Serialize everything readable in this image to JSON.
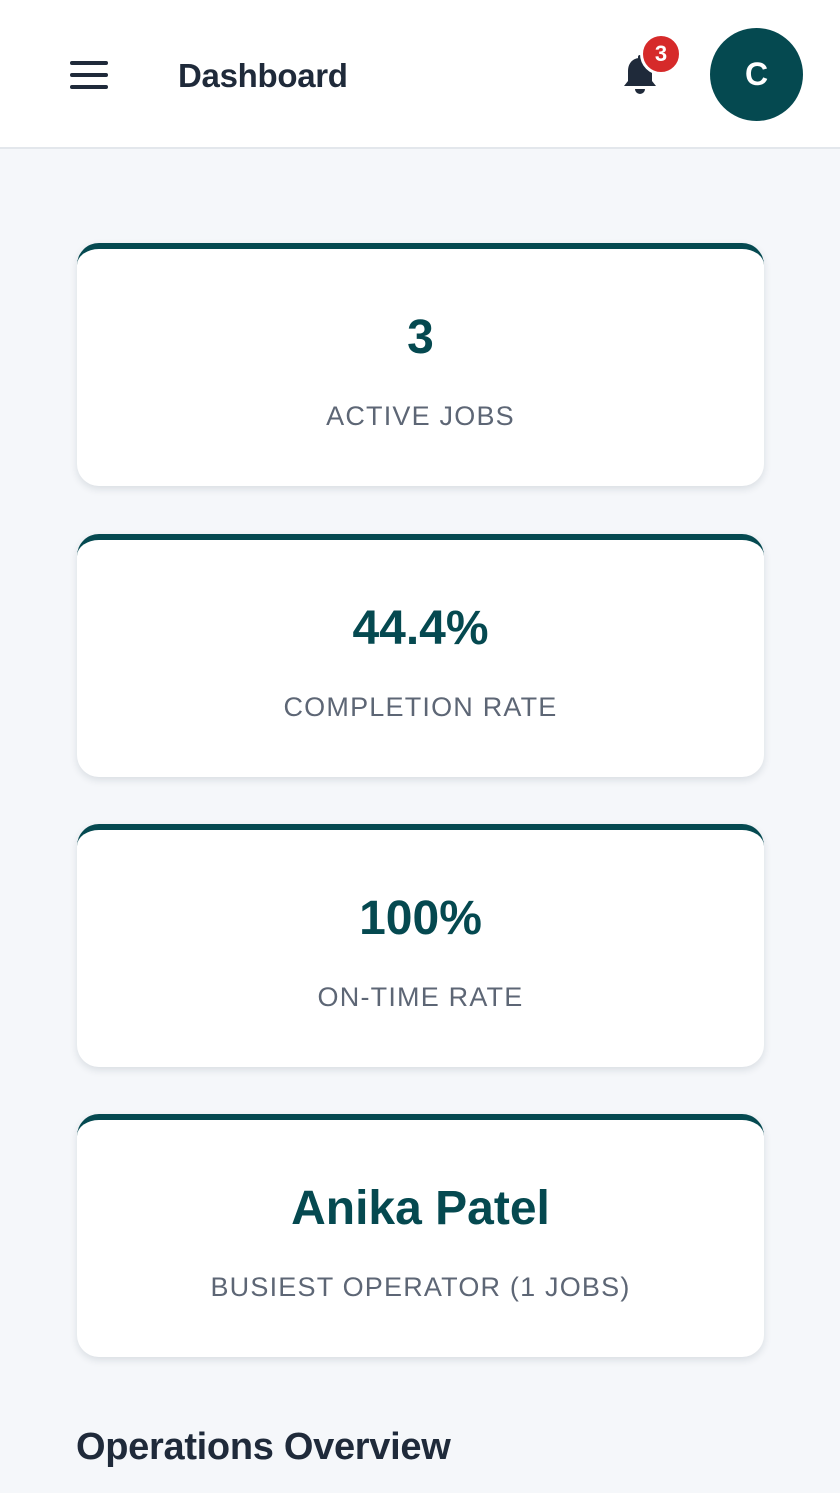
{
  "header": {
    "title": "Dashboard",
    "menu_icon": "hamburger-menu-icon",
    "bell_icon": "bell-icon",
    "notification_count": "3",
    "avatar_initial": "C",
    "brand_color": "#054950",
    "badge_color": "#d62a2a"
  },
  "stats": [
    {
      "value": "3",
      "label": "ACTIVE JOBS"
    },
    {
      "value": "44.4%",
      "label": "COMPLETION RATE"
    },
    {
      "value": "100%",
      "label": "ON-TIME RATE"
    },
    {
      "value": "Anika Patel",
      "label": "BUSIEST OPERATOR (1 JOBS)"
    }
  ],
  "sections": {
    "operations_title": "Operations Overview"
  }
}
